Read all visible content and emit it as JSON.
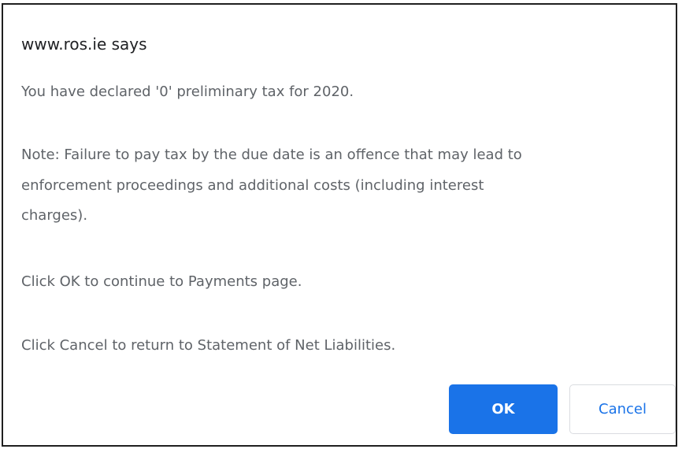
{
  "dialog": {
    "title": "www.ros.ie says",
    "messages": [
      "You have declared '0' preliminary tax for  2020.",
      "Note: Failure to pay tax by the due date is an offence that may lead to",
      "enforcement proceedings and additional costs (including interest",
      "charges).",
      "Click OK to continue to Payments page.",
      "Click Cancel to return to Statement of Net Liabilities."
    ],
    "ok_label": "OK",
    "cancel_label": "Cancel"
  },
  "colors": {
    "primary": "#1a73e8",
    "text": "#5f6368",
    "title": "#202124",
    "border": "#202020"
  }
}
